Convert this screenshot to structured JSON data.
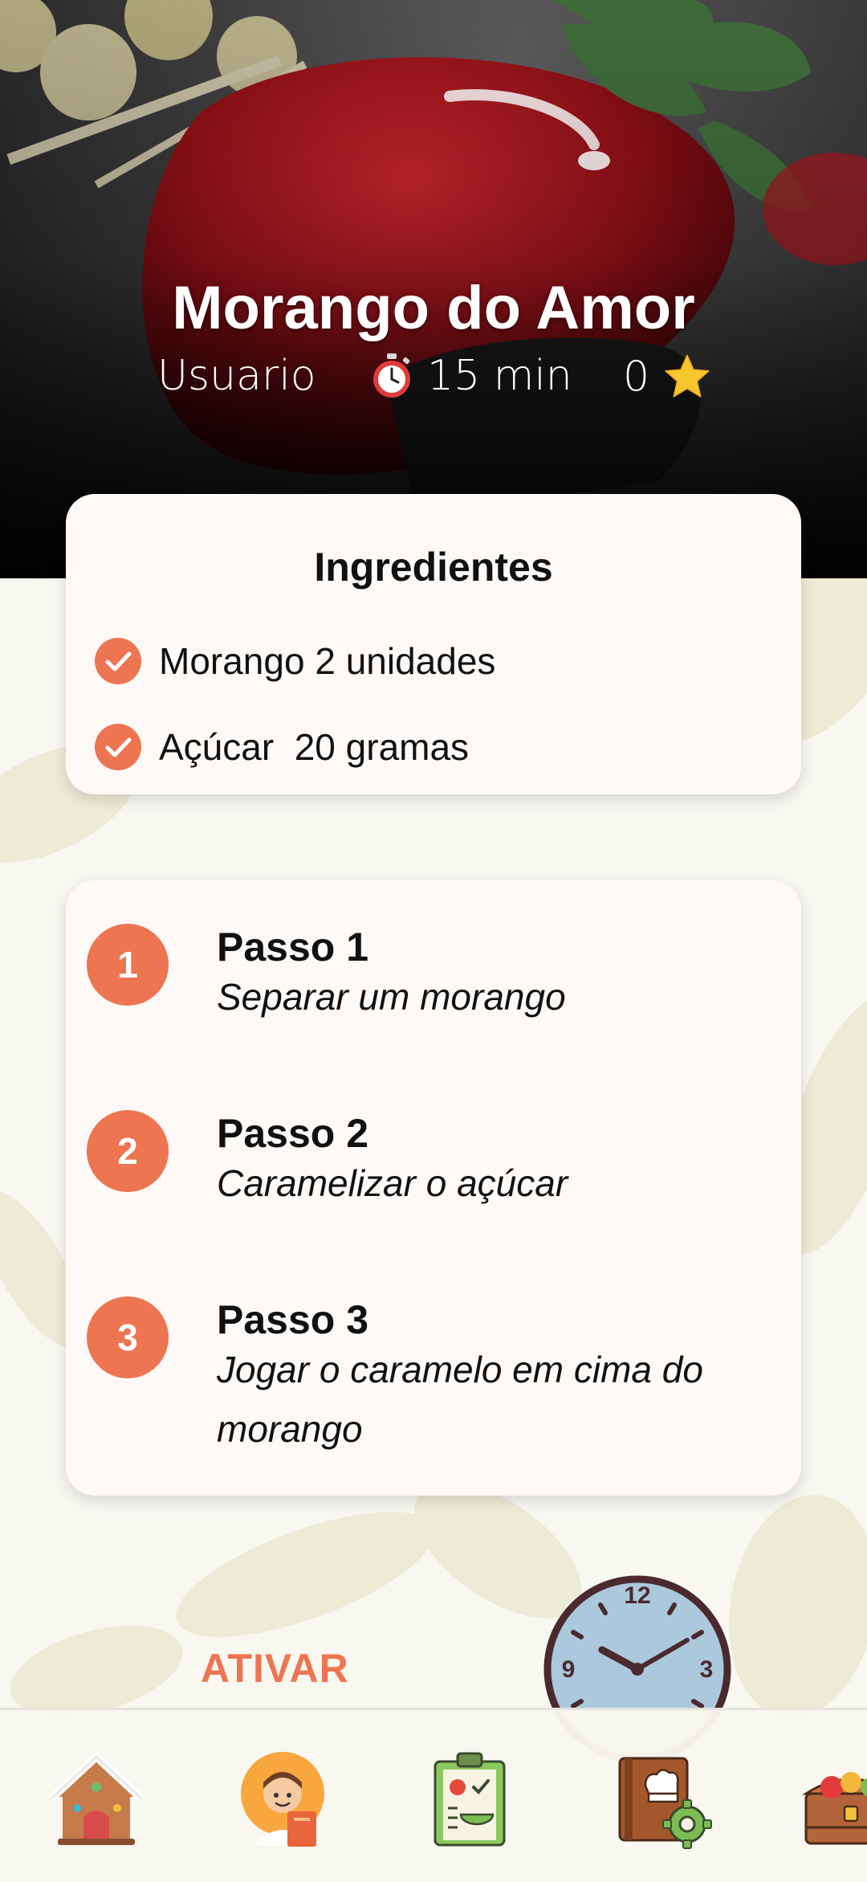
{
  "recipe": {
    "title": "Morango do Amor",
    "author": "Usuario",
    "time": "15 min",
    "rating": "0"
  },
  "ingredients": {
    "title": "Ingredientes",
    "items": [
      "Morango 2 unidades",
      "Açúcar  20 gramas"
    ]
  },
  "steps": [
    {
      "number": "1",
      "title": "Passo 1",
      "description": "Separar um morango"
    },
    {
      "number": "2",
      "title": "Passo 2",
      "description": "Caramelizar o açúcar"
    },
    {
      "number": "3",
      "title": "Passo 3",
      "description": "Jogar o caramelo em cima do morango"
    }
  ],
  "timer": {
    "activate_label": "ATIVAR",
    "clock_numbers": [
      "12",
      "3",
      "9"
    ]
  },
  "bottom_nav": {
    "icons": [
      "gingerbread-house-icon",
      "chef-reading-icon",
      "recipe-checklist-icon",
      "cookbook-settings-icon",
      "food-chest-icon"
    ]
  },
  "colors": {
    "accent": "#ED7552",
    "background": "#F8F7F0",
    "card": "#FDF9F7"
  }
}
